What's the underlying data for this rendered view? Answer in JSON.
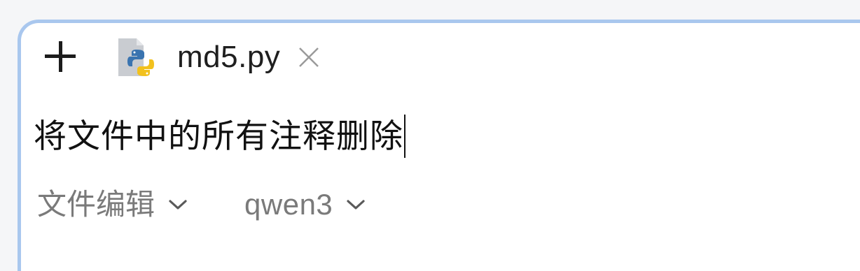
{
  "toolbar": {
    "add_icon": "plus-icon"
  },
  "file_tab": {
    "icon": "python-file-icon",
    "name": "md5.py",
    "close_icon": "close-icon"
  },
  "prompt": {
    "text": "将文件中的所有注释删除"
  },
  "selectors": {
    "mode_label": "文件编辑",
    "model_label": "qwen3"
  },
  "colors": {
    "panel_border": "#a9c7ee",
    "python_blue": "#3a74b0",
    "python_yellow": "#f2c11d"
  }
}
